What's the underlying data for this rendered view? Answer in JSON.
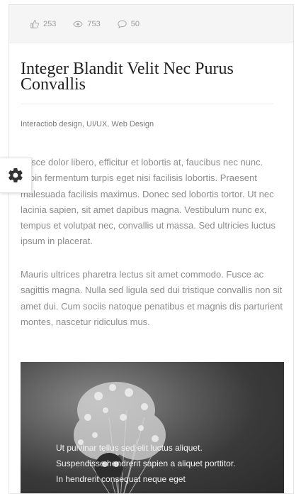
{
  "post": {
    "stats": {
      "likes": "253",
      "views": "753",
      "comments": "50"
    },
    "title": "Integer Blandit Velit Nec Purus Convallis",
    "categories": "Interactiob design, UI/UX, Web Design",
    "paragraphs": [
      "Fusce dolor libero, efficitur et lobortis at, faucibus nec nunc. Proin fermentum turpis eget nisi facilisis lobortis. Praesent malesuada facilisis maximus. Donec sed lobortis tortor. Ut nec lacinia sapien, sit amet dapibus magna. Vestibulum nunc ex, tempus et volutpat nec, convallis ut massa. Sed ultricies luctus ipsum in placerat.",
      "Mauris ultrices pharetra lectus sit amet commodo. Fusce ac sagittis magna. Nulla sed ligula sed dui tristique convallis non sit amet dui. Cum sociis natoque penatibus et magnis dis parturient montes, nascetur ridiculus mus."
    ],
    "image_caption": "Ut pulvinar tellus sed elit luctus aliquet. Suspendisse hendrerit sapien a aliquet porttitor. In hendrerit consequat neque eget"
  },
  "icons": {
    "likes": "thumbs-up-icon",
    "views": "eye-icon",
    "comments": "comment-icon",
    "settings": "gear-icon"
  },
  "colors": {
    "stats_bar": "#f5f5f5",
    "body_text": "#8c8c8c",
    "title_text": "#222222",
    "gear": "#333333"
  }
}
